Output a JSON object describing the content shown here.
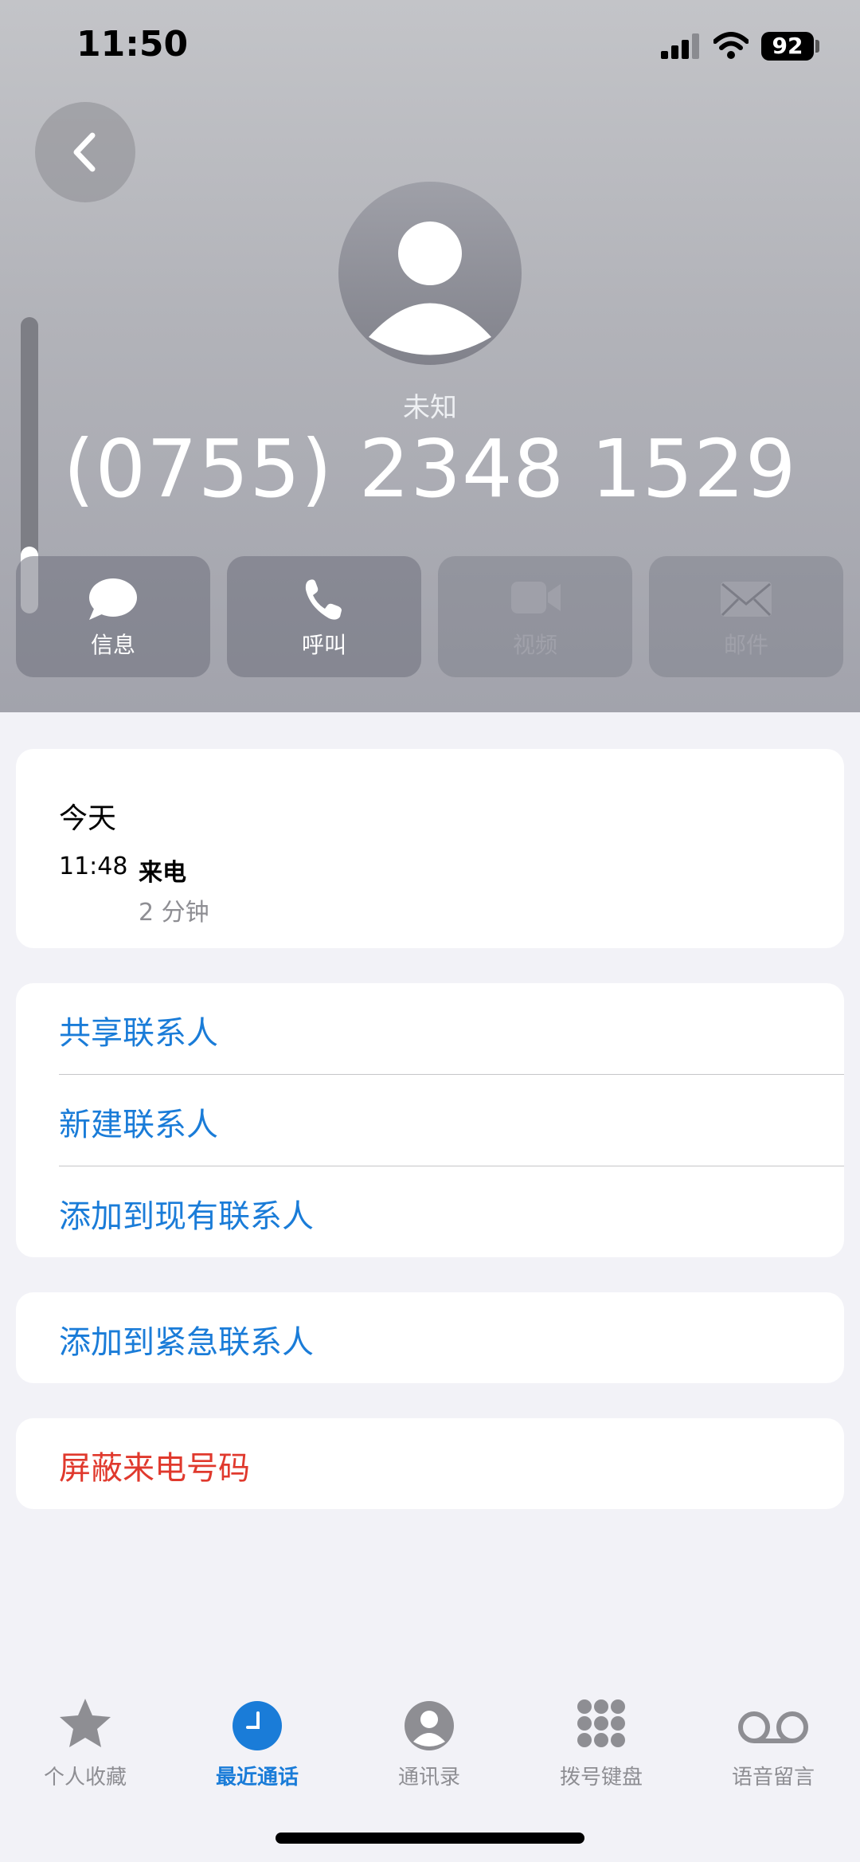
{
  "status_bar": {
    "time": "11:50",
    "battery": "92"
  },
  "contact": {
    "label": "未知",
    "phone": "(0755) 2348 1529"
  },
  "actions": [
    {
      "label": "信息",
      "icon": "message-icon",
      "enabled": true
    },
    {
      "label": "呼叫",
      "icon": "phone-icon",
      "enabled": true
    },
    {
      "label": "视频",
      "icon": "video-icon",
      "enabled": false
    },
    {
      "label": "邮件",
      "icon": "mail-icon",
      "enabled": false
    }
  ],
  "recent": {
    "day": "今天",
    "time": "11:48",
    "type": "来电",
    "duration": "2 分钟"
  },
  "options": {
    "share": "共享联系人",
    "new": "新建联系人",
    "add_existing": "添加到现有联系人",
    "add_emergency": "添加到紧急联系人",
    "block": "屏蔽来电号码"
  },
  "tabs": [
    {
      "label": "个人收藏",
      "icon": "star-icon",
      "active": false
    },
    {
      "label": "最近通话",
      "icon": "clock-icon",
      "active": true
    },
    {
      "label": "通讯录",
      "icon": "person-icon",
      "active": false
    },
    {
      "label": "拨号键盘",
      "icon": "keypad-icon",
      "active": false
    },
    {
      "label": "语音留言",
      "icon": "voicemail-icon",
      "active": false
    }
  ],
  "colors": {
    "accent": "#1a7cd8",
    "destructive": "#e0392d",
    "background": "#f2f2f7"
  }
}
